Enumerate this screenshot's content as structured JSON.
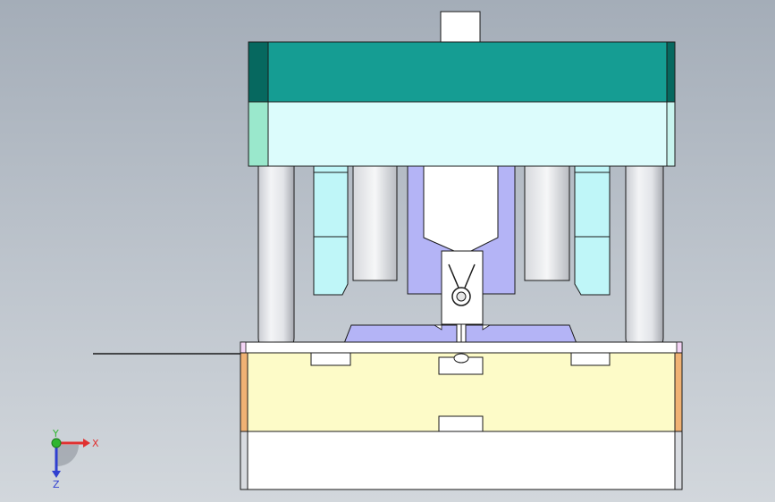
{
  "viewport": {
    "background_top": "#a4adb8",
    "background_bottom": "#d2d7dc"
  },
  "colors": {
    "top_clamp_plate": "#159d93",
    "top_clamp_plate_dark": "#06685f",
    "cavity_plate": "#dcfcfc",
    "cavity_plate_edge": "#9ae8cc",
    "slide_block": "#bff6f8",
    "guide_pillar": "#e4e6ea",
    "punch": "#b4b4f6",
    "core_plate": "#fdfbc8",
    "core_plate_edge": "#f0b274",
    "bottom_plate": "#ffffff",
    "pink_marker": "#f3d4f5",
    "outline": "#1a1a1a"
  },
  "triad": {
    "x_label": "X",
    "y_label": "Y",
    "z_label": "Z",
    "x_color": "#e03030",
    "y_color": "#2fb52f",
    "z_color": "#2f3fd0"
  }
}
